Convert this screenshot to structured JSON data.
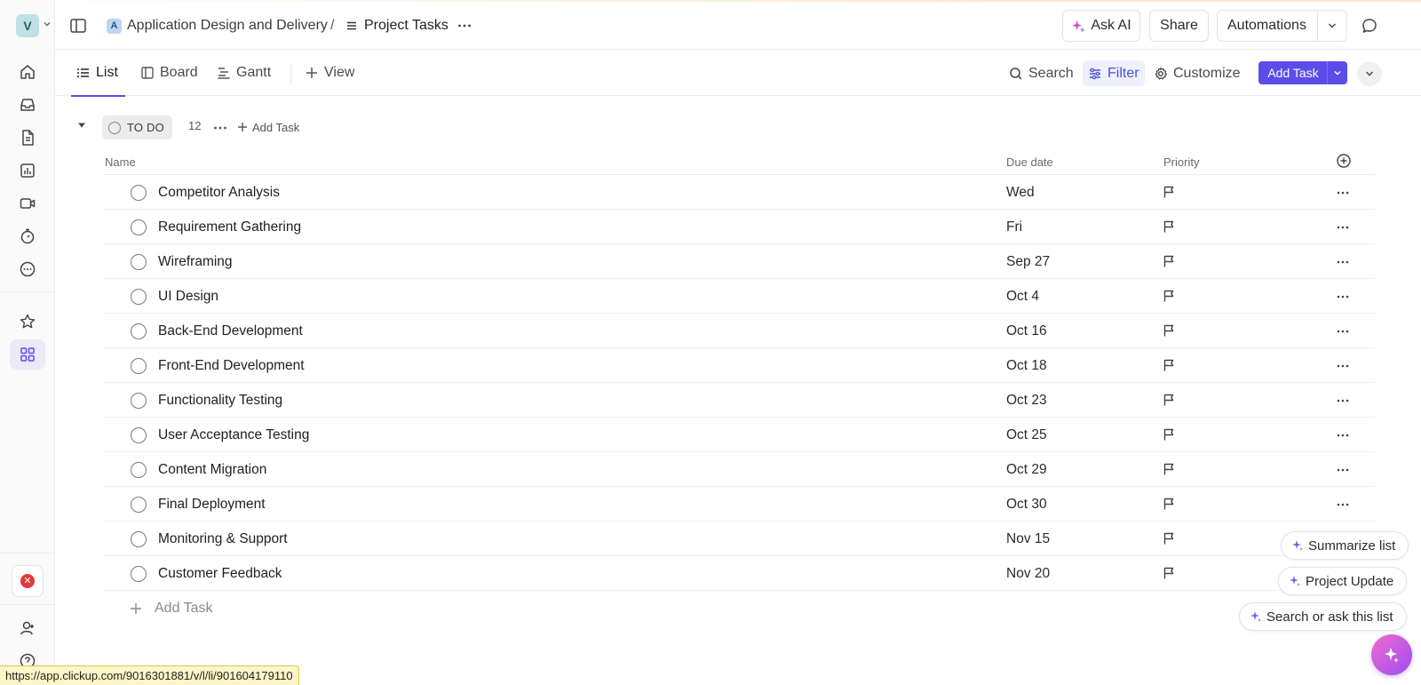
{
  "workspace": {
    "initial": "V"
  },
  "breadcrumb": {
    "space_initial": "A",
    "space_name": "Application Design and Delivery",
    "separator": "/",
    "list_name": "Project Tasks"
  },
  "topbar": {
    "ask_ai": "Ask AI",
    "share": "Share",
    "automations": "Automations"
  },
  "views": {
    "tabs": [
      {
        "label": "List",
        "icon": "list-icon",
        "active": true
      },
      {
        "label": "Board",
        "icon": "board-icon",
        "active": false
      },
      {
        "label": "Gantt",
        "icon": "gantt-icon",
        "active": false
      }
    ],
    "add_view": "View"
  },
  "toolbar": {
    "search": "Search",
    "filter": "Filter",
    "customize": "Customize",
    "add_task": "Add Task"
  },
  "group": {
    "status": "TO DO",
    "count": "12",
    "add_task": "Add Task"
  },
  "table": {
    "columns": {
      "name": "Name",
      "due": "Due date",
      "priority": "Priority"
    },
    "rows": [
      {
        "name": "Competitor Analysis",
        "due": "Wed"
      },
      {
        "name": "Requirement Gathering",
        "due": "Fri"
      },
      {
        "name": "Wireframing",
        "due": "Sep 27"
      },
      {
        "name": "UI Design",
        "due": "Oct 4"
      },
      {
        "name": "Back-End Development",
        "due": "Oct 16"
      },
      {
        "name": "Front-End Development",
        "due": "Oct 18"
      },
      {
        "name": "Functionality Testing",
        "due": "Oct 23"
      },
      {
        "name": "User Acceptance Testing",
        "due": "Oct 25"
      },
      {
        "name": "Content Migration",
        "due": "Oct 29"
      },
      {
        "name": "Final Deployment",
        "due": "Oct 30"
      },
      {
        "name": "Monitoring & Support",
        "due": "Nov 15"
      },
      {
        "name": "Customer Feedback",
        "due": "Nov 20"
      }
    ],
    "add_task": "Add Task"
  },
  "ai_chips": {
    "summarize": "Summarize list",
    "project_update": "Project Update",
    "search_ask": "Search or ask this list"
  },
  "status_url": "https://app.clickup.com/9016301881/v/l/li/901604179110",
  "colors": {
    "accent": "#5b4ee8",
    "filter_bg": "#eef0fd",
    "error": "#e03a3a",
    "ai_gradient_start": "#f06bd0",
    "ai_gradient_end": "#9b4ef0"
  }
}
